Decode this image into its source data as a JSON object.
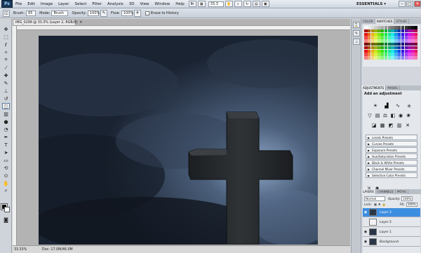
{
  "menubar": {
    "logo": "Ps",
    "items": [
      "File",
      "Edit",
      "Image",
      "Layer",
      "Select",
      "Filter",
      "Analysis",
      "3D",
      "View",
      "Window",
      "Help"
    ],
    "zoom": "33.3",
    "workspace": "ESSENTIALS ▾",
    "window_buttons": [
      "–",
      "□",
      "✕"
    ]
  },
  "options": {
    "brush_label": "Brush:",
    "brush_size": "65",
    "mode_label": "Mode:",
    "mode_value": "Brush",
    "opacity_label": "Opacity:",
    "opacity_value": "100%",
    "flow_label": "Flow:",
    "flow_value": "100%",
    "history_label": "Erase to History"
  },
  "document": {
    "tab_title": "IMG_0298 @ 33.3% (Layer 2, RGB/8)",
    "tab_close": "✕",
    "zoom_pct": "33.33%",
    "doc_size": "Doc: 17.0M/46.0M"
  },
  "panels": {
    "swatch_tabs": [
      "COLOR",
      "SWATCHES",
      "STYLES"
    ],
    "adjust_tabs": [
      "ADJUSTMENTS",
      "MASKS"
    ],
    "adjust_title": "Add an adjustment",
    "presets": [
      "Levels Presets",
      "Curves Presets",
      "Exposure Presets",
      "Hue/Saturation Presets",
      "Black & White Presets",
      "Channel Mixer Presets",
      "Selective Color Presets"
    ],
    "layer_tabs": [
      "LAYERS",
      "CHANNELS",
      "PATHS"
    ],
    "blend_mode": "Normal",
    "opacity_label": "Opacity:",
    "opacity_value": "100%",
    "lock_label": "Lock:",
    "fill_label": "Fill:",
    "fill_value": "100%",
    "layers": [
      {
        "name": "Layer 2",
        "selected": true
      },
      {
        "name": "Layer 2",
        "selected": false
      },
      {
        "name": "Layer 1",
        "selected": false
      },
      {
        "name": "Background",
        "selected": false
      }
    ]
  },
  "colors": {
    "accent": "#3d8ee0",
    "foreground": "#000000",
    "background": "#ffffff"
  }
}
